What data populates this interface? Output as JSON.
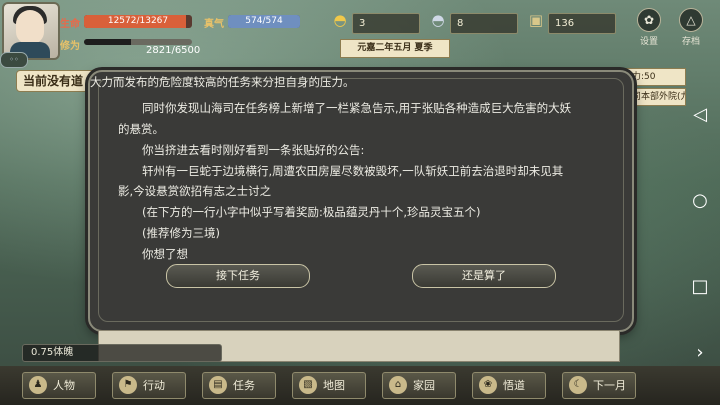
{
  "player": {
    "hp_label": "生命",
    "hp_value": "12572/13267",
    "hp_fraction": 0.948,
    "qi_label": "真气",
    "qi_value": "574/574",
    "qi_fraction": 1.0,
    "cultivation_label": "修为",
    "cultivation_value": "2821/6500",
    "cultivation_fraction": 0.434
  },
  "resources": [
    {
      "icon": "gold-ingot-icon",
      "value": "3"
    },
    {
      "icon": "silver-ingot-icon",
      "value": "8"
    },
    {
      "icon": "copper-coin-icon",
      "value": "136"
    }
  ],
  "date": "元嘉二年五月  夏季",
  "system_buttons": {
    "settings": "设置",
    "save": "存档"
  },
  "notice": "当前没有道",
  "side_tags": [
    "动力:50",
    "海司本部外院(九"
  ],
  "dialog": {
    "lines": [
      "大力而发布的危险度较高的任务来分担自身的压力。",
      "同时你发现山海司在任务榜上新增了一栏紧急告示,用于张贴各种造成巨大危害的大妖",
      "的悬赏。",
      "你当挤进去看时刚好看到一条张贴好的公告:",
      "轩州有一巨蛇于边境横行,周遭农田房屋尽数被毁坏,一队斩妖卫前去治退时却未见其",
      "影,今设悬赏欲招有志之士讨之",
      "(在下方的一行小字中似乎写着奖励:极品蕴灵丹十个,珍品灵宝五个)",
      "(推荐修为三境)",
      "你想了想"
    ],
    "accept": "接下任务",
    "decline": "还是算了"
  },
  "stamina": "0.75体魄",
  "menu": [
    {
      "label": "人物",
      "icon": "person-icon"
    },
    {
      "label": "行动",
      "icon": "action-icon"
    },
    {
      "label": "任务",
      "icon": "task-icon"
    },
    {
      "label": "地图",
      "icon": "map-icon"
    },
    {
      "label": "家园",
      "icon": "home-icon"
    },
    {
      "label": "悟道",
      "icon": "enlighten-icon"
    },
    {
      "label": "下一月",
      "icon": "moon-icon"
    }
  ],
  "colors": {
    "hp": "#d9603a",
    "qi": "#6f8fbf",
    "cultivation": "#222222"
  }
}
